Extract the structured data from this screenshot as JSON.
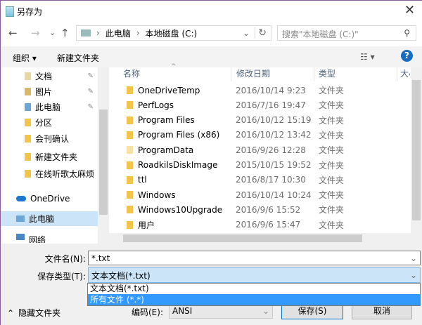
{
  "window": {
    "title": "另存为",
    "close": "✕"
  },
  "nav": {
    "back": "←",
    "forward": "→",
    "recent": "⌄",
    "up": "↑",
    "breadcrumb": [
      "此电脑",
      "本地磁盘 (C:)"
    ],
    "sep": "›",
    "refresh": "↻",
    "dropdown": "⌄",
    "search_placeholder": "搜索\"本地磁盘 (C:)\"",
    "search_icon": "⚲"
  },
  "toolbar": {
    "organize": "组织 ▾",
    "new_folder": "新建文件夹",
    "view": "☷ ▾",
    "help": "?"
  },
  "sidebar": {
    "items": [
      {
        "label": "文档",
        "pinned": true
      },
      {
        "label": "图片",
        "pinned": true
      },
      {
        "label": "此电脑",
        "pinned": true
      },
      {
        "label": "分区"
      },
      {
        "label": "会刊确认"
      },
      {
        "label": "新建文件夹"
      },
      {
        "label": "在线听歌太麻烦"
      },
      {
        "label": "OneDrive"
      },
      {
        "label": "此电脑",
        "selected": true
      },
      {
        "label": "网络"
      }
    ],
    "pin_glyph": "📌"
  },
  "columns": [
    "名称",
    "修改日期",
    "类型",
    "大小"
  ],
  "files": [
    {
      "name": "OneDriveTemp",
      "date": "2016/10/14 9:23",
      "type": "文件夹"
    },
    {
      "name": "PerfLogs",
      "date": "2016/7/16 19:47",
      "type": "文件夹"
    },
    {
      "name": "Program Files",
      "date": "2016/10/12 15:19",
      "type": "文件夹"
    },
    {
      "name": "Program Files (x86)",
      "date": "2016/10/12 13:42",
      "type": "文件夹"
    },
    {
      "name": "ProgramData",
      "date": "2016/9/26 12:28",
      "type": "文件夹"
    },
    {
      "name": "RoadkilsDiskImage",
      "date": "2015/10/15 19:52",
      "type": "文件夹"
    },
    {
      "name": "ttl",
      "date": "2016/8/17 10:30",
      "type": "文件夹"
    },
    {
      "name": "Windows",
      "date": "2016/10/14 10:24",
      "type": "文件夹"
    },
    {
      "name": "Windows10Upgrade",
      "date": "2016/9/6 15:52",
      "type": "文件夹"
    },
    {
      "name": "用户",
      "date": "2016/9/6 15:47",
      "type": "文件夹"
    }
  ],
  "form": {
    "filename_label": "文件名(N):",
    "filename_value": "*.txt",
    "type_label": "保存类型(T):",
    "type_value": "文本文档(*.txt)",
    "type_options": [
      "文本文档(*.txt)",
      "所有文件  (*.*)"
    ],
    "hide_folders": "隐藏文件夹",
    "encoding_label": "编码(E):",
    "encoding_value": "ANSI",
    "save": "保存(S)",
    "cancel": "取消",
    "chev": "⌄"
  }
}
